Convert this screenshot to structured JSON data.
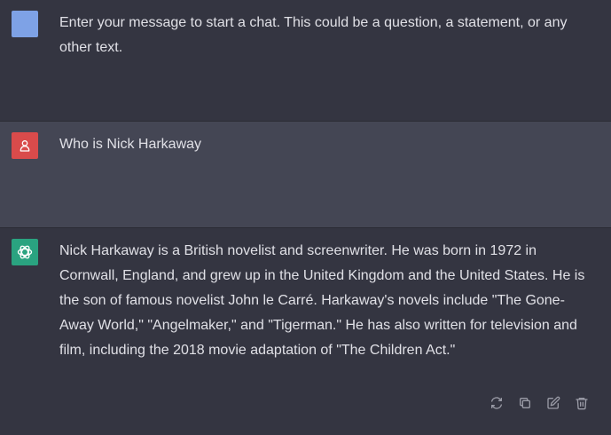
{
  "colors": {
    "system_avatar": "#7ea2e6",
    "user_avatar": "#d94b4b",
    "assistant_avatar": "#2aa380",
    "icon": "#9a9ba6"
  },
  "messages": {
    "system": {
      "text": "Enter your message to start a chat. This could be a question, a statement, or any other text."
    },
    "user": {
      "avatar_icon": "user-icon",
      "text": "Who is Nick Harkaway"
    },
    "assistant": {
      "avatar_icon": "openai-logo-icon",
      "text": "Nick Harkaway is a British novelist and screenwriter. He was born in 1972 in Cornwall, England, and grew up in the United Kingdom and the United States. He is the son of famous novelist John le Carré. Harkaway's novels include \"The Gone-Away World,\" \"Angelmaker,\" and \"Tigerman.\" He has also written for television and film, including the 2018 movie adaptation of \"The Children Act.\""
    }
  },
  "actions": [
    {
      "name": "regenerate",
      "icon": "refresh-icon"
    },
    {
      "name": "copy",
      "icon": "copy-icon"
    },
    {
      "name": "edit",
      "icon": "edit-icon"
    },
    {
      "name": "delete",
      "icon": "trash-icon"
    }
  ]
}
